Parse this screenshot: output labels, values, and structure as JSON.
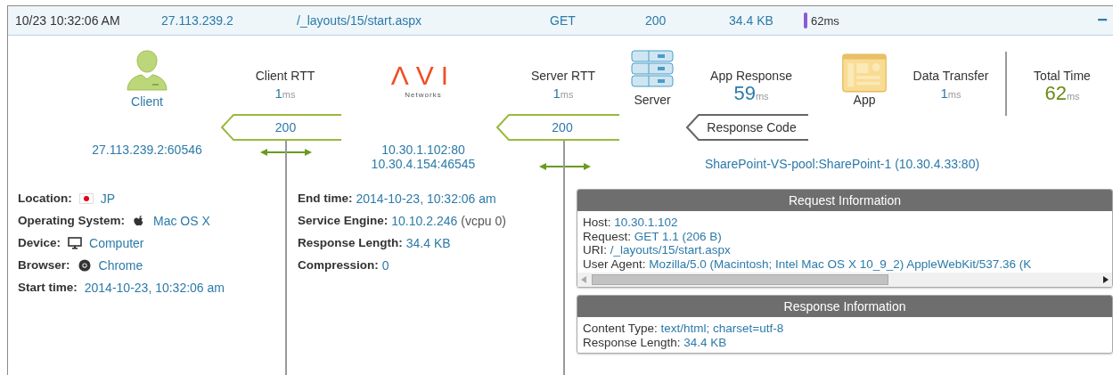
{
  "row": {
    "time": "10/23 10:32:06 AM",
    "client_ip": "27.113.239.2",
    "uri": "/_layouts/15/start.aspx",
    "method": "GET",
    "status": "200",
    "size": "34.4 KB",
    "duration": "62ms",
    "collapse": "−"
  },
  "client": {
    "label": "Client",
    "address": "27.113.239.2:60546"
  },
  "client_rtt": {
    "label": "Client RTT",
    "value": "1",
    "unit": "ms",
    "code": "200"
  },
  "load_balancer": {
    "logo": "ΛVI",
    "tagline": "Networks",
    "addresses": [
      "10.30.1.102:80",
      "10.30.4.154:46545"
    ]
  },
  "server_rtt": {
    "label": "Server RTT",
    "value": "1",
    "unit": "ms",
    "code": "200"
  },
  "server": {
    "label": "Server",
    "pool": "SharePoint-VS-pool:SharePoint-1 (10.30.4.33:80)"
  },
  "app_response": {
    "label": "App Response",
    "value": "59",
    "unit": "ms"
  },
  "response_code": {
    "label": "Response Code"
  },
  "app": {
    "label": "App"
  },
  "data_transfer": {
    "label": "Data Transfer",
    "value": "1",
    "unit": "ms"
  },
  "total_time": {
    "label": "Total Time",
    "value": "62",
    "unit": "ms"
  },
  "client_details": [
    {
      "label": "Location:",
      "kind": "flag",
      "value": "JP"
    },
    {
      "label": "Operating System:",
      "kind": "apple",
      "value": "Mac OS X"
    },
    {
      "label": "Device:",
      "kind": "monitor",
      "value": "Computer"
    },
    {
      "label": "Browser:",
      "kind": "chrome",
      "value": "Chrome"
    },
    {
      "label": "Start time:",
      "kind": "plain",
      "value": "2014-10-23, 10:32:06 am"
    }
  ],
  "connection_details": [
    {
      "label": "End time:",
      "value": "2014-10-23, 10:32:06 am"
    },
    {
      "label": "Service Engine:",
      "value": "10.10.2.246",
      "note": "(vcpu 0)"
    },
    {
      "label": "Response Length:",
      "value": "34.4 KB"
    },
    {
      "label": "Compression:",
      "value": "0"
    }
  ],
  "request_information": {
    "title": "Request Information",
    "fields": [
      {
        "label": "Host:",
        "value": "10.30.1.102"
      },
      {
        "label": "Request:",
        "value": "GET 1.1 (206 B)"
      },
      {
        "label": "URI:",
        "value": "/_layouts/15/start.aspx"
      },
      {
        "label": "User Agent:",
        "value": "Mozilla/5.0 (Macintosh; Intel Mac OS X 10_9_2) AppleWebKit/537.36 (K"
      }
    ]
  },
  "response_information": {
    "title": "Response Information",
    "fields": [
      {
        "label": "Content Type:",
        "value": "text/html; charset=utf-8"
      },
      {
        "label": "Response Length:",
        "value": "34.4 KB"
      }
    ]
  }
}
